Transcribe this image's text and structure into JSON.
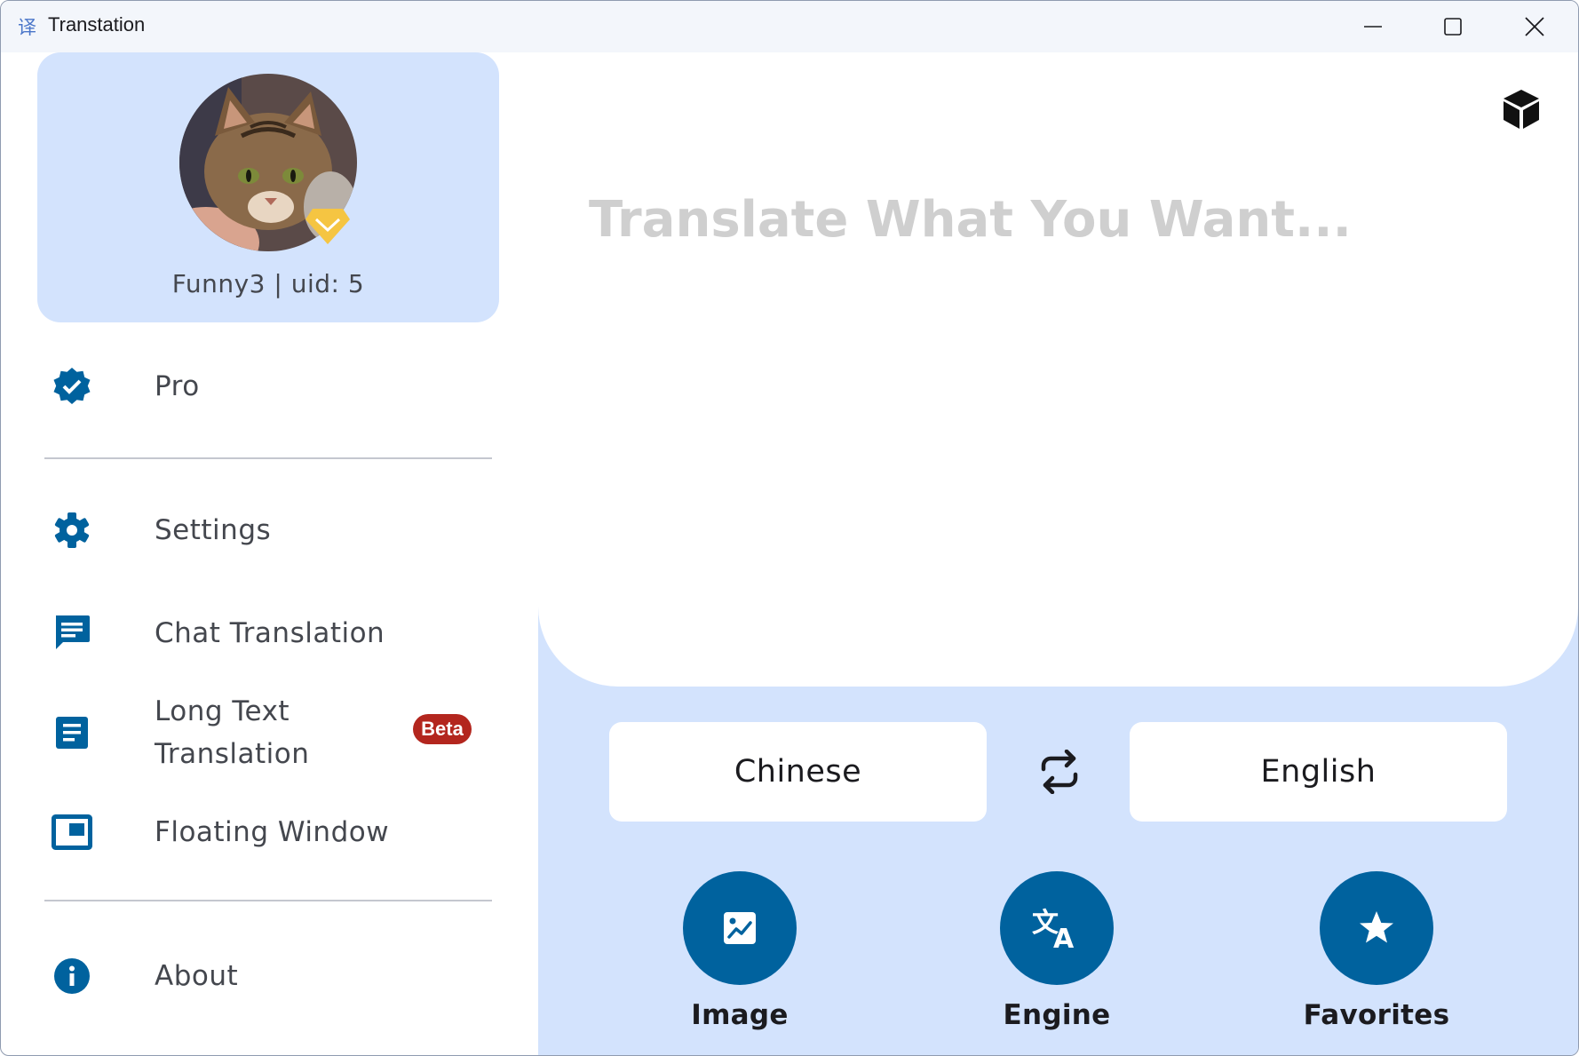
{
  "window": {
    "title": "Transtation"
  },
  "profile": {
    "user_line": "Funny3 | uid: 5"
  },
  "sidebar": {
    "items": [
      {
        "label": "Pro",
        "icon": "verified-badge-icon"
      },
      {
        "label": "Settings",
        "icon": "gear-icon"
      },
      {
        "label": "Chat Translation",
        "icon": "chat-icon"
      },
      {
        "label": "Long Text\nTranslation",
        "icon": "document-icon",
        "badge": "Beta"
      },
      {
        "label": "Floating Window",
        "icon": "floating-window-icon"
      },
      {
        "label": "About",
        "icon": "info-icon"
      }
    ]
  },
  "main": {
    "input_placeholder": "Translate What You Want...",
    "source_language": "Chinese",
    "target_language": "English",
    "actions": [
      {
        "label": "Image",
        "icon": "image-icon"
      },
      {
        "label": "Engine",
        "icon": "translate-icon"
      },
      {
        "label": "Favorites",
        "icon": "star-icon"
      }
    ]
  },
  "colors": {
    "accent": "#00629e",
    "card_background": "#d3e3fd",
    "beta_badge": "#b3261e",
    "vip_badge": "#f5c542"
  }
}
